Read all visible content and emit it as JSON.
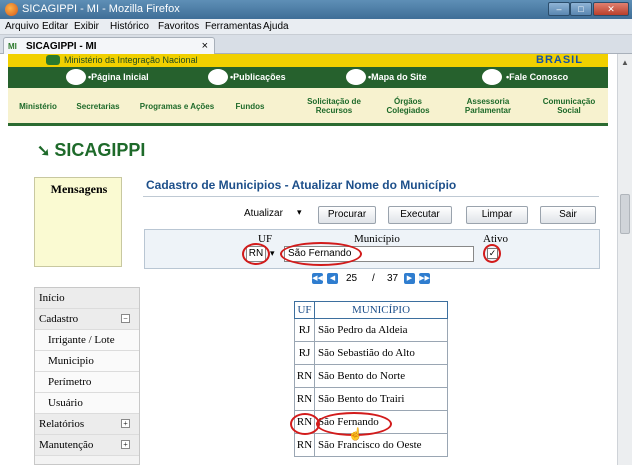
{
  "window": {
    "title": "SICAGIPPI - MI - Mozilla Firefox",
    "min": "–",
    "max": "□",
    "close": "✕"
  },
  "menubar": [
    "Arquivo",
    "Editar",
    "Exibir",
    "Histórico",
    "Favoritos",
    "Ferramentas",
    "Ajuda"
  ],
  "tab": {
    "label": "SICAGIPPI - MI",
    "close": "×"
  },
  "gov": {
    "ministry": "Ministério da Integração Nacional",
    "brand": "BRASIL",
    "links": [
      "•Página Inicial",
      "•Publicações",
      "•Mapa do Site",
      "•Fale Conosco"
    ]
  },
  "secnav": [
    {
      "line1": "Ministério",
      "line2": ""
    },
    {
      "line1": "Secretarias",
      "line2": ""
    },
    {
      "line1": "Programas e Ações",
      "line2": ""
    },
    {
      "line1": "Fundos",
      "line2": ""
    },
    {
      "line1": "Solicitação de",
      "line2": "Recursos"
    },
    {
      "line1": "Órgãos",
      "line2": "Colegiados"
    },
    {
      "line1": "Assessoria",
      "line2": "Parlamentar"
    },
    {
      "line1": "Comunicação",
      "line2": "Social"
    }
  ],
  "logo": {
    "text": "SICAGIPPI"
  },
  "messages": {
    "title": "Mensagens"
  },
  "page": {
    "title": "Cadastro de Municipios - Atualizar Nome do Município"
  },
  "toolbar": {
    "atualizar": "Atualizar",
    "procurar": "Procurar",
    "executar": "Executar",
    "limpar": "Limpar",
    "sair": "Sair"
  },
  "filter": {
    "uf_label": "UF",
    "municipio_label": "Município",
    "ativo_label": "Ativo",
    "uf_value": "RN",
    "municipio_value": "São Fernando",
    "ativo_checked": true
  },
  "pager": {
    "current": "25",
    "separator": "/",
    "total": "37"
  },
  "sidemenu": [
    {
      "label": "Início",
      "level": 0,
      "toggle": ""
    },
    {
      "label": "Cadastro",
      "level": 0,
      "toggle": "−"
    },
    {
      "label": "Irrigante / Lote",
      "level": 1,
      "toggle": ""
    },
    {
      "label": "Municipio",
      "level": 1,
      "toggle": ""
    },
    {
      "label": "Perímetro",
      "level": 1,
      "toggle": ""
    },
    {
      "label": "Usuário",
      "level": 1,
      "toggle": ""
    },
    {
      "label": "Relatórios",
      "level": 0,
      "toggle": "+"
    },
    {
      "label": "Manutenção",
      "level": 0,
      "toggle": "+"
    }
  ],
  "table": {
    "headers": [
      "UF",
      "MUNICÍPIO"
    ],
    "rows": [
      {
        "uf": "RJ",
        "municipio": "São Pedro da Aldeia"
      },
      {
        "uf": "RJ",
        "municipio": "São Sebastião do Alto"
      },
      {
        "uf": "RN",
        "municipio": "São Bento do Norte"
      },
      {
        "uf": "RN",
        "municipio": "São Bento do Trairi"
      },
      {
        "uf": "RN",
        "municipio": "São Fernando"
      },
      {
        "uf": "RN",
        "municipio": "São Francisco do Oeste"
      }
    ]
  },
  "colors": {
    "gov_green": "#26612d",
    "gov_yellow": "#f1d000",
    "title_blue": "#1d4f8a",
    "highlight_red": "#d21b1b"
  }
}
